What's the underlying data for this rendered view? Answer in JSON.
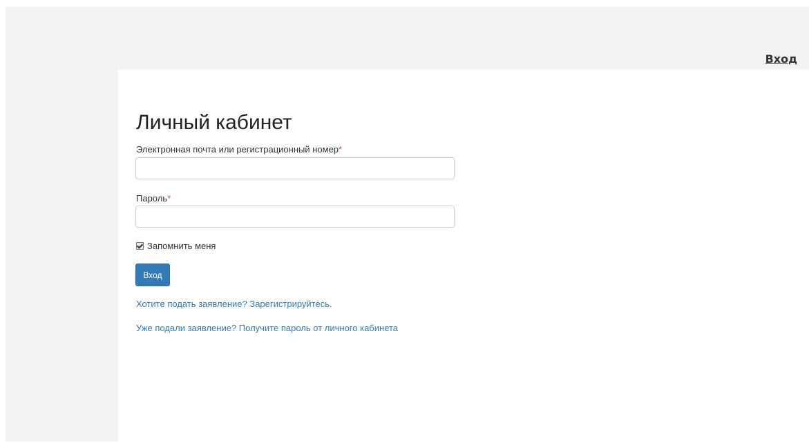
{
  "header": {
    "login_link": "Вход"
  },
  "form": {
    "title": "Личный кабинет",
    "email_label": "Электронная почта или регистрационный номер",
    "email_value": "",
    "password_label": "Пароль",
    "password_value": "",
    "required_mark": "*",
    "remember_label": "Запомнить меня",
    "remember_checked": true,
    "submit_label": "Вход",
    "register_link": "Хотите подать заявление? Зарегистрируйтесь.",
    "get_password_link": "Уже подали заявление? Получите пароль от личного кабинета"
  },
  "colors": {
    "primary": "#337ab7",
    "required": "#d9534f",
    "background": "#f2f2f2"
  }
}
